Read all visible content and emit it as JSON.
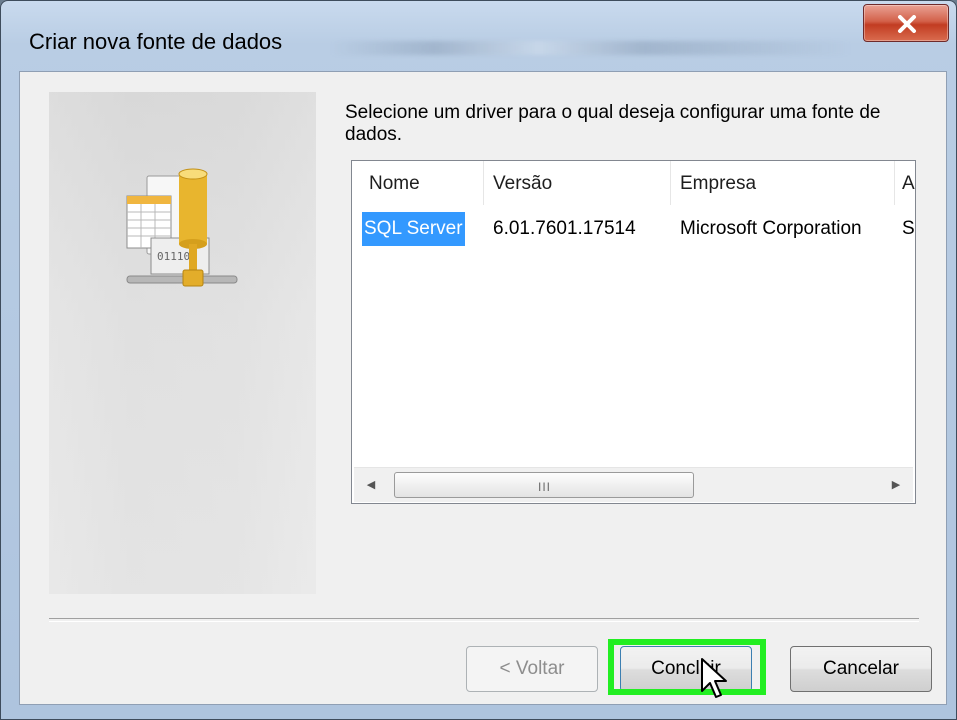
{
  "window": {
    "title": "Criar nova fonte de dados",
    "close_icon": "close-icon"
  },
  "side_panel": {
    "icon": "data-source-driver-icon"
  },
  "instruction": "Selecione um driver para o qual deseja configurar uma fonte de dados.",
  "driver_list": {
    "columns": [
      "Nome",
      "Versão",
      "Empresa",
      "A"
    ],
    "rows": [
      {
        "name": "SQL Server",
        "version": "6.01.7601.17514",
        "company": "Microsoft Corporation",
        "extra": "S",
        "selected": true
      }
    ],
    "scrollbar": {
      "left_icon": "scroll-left-icon",
      "right_icon": "scroll-right-icon",
      "grip": "III"
    }
  },
  "buttons": {
    "back_label": "< Voltar",
    "finish_label": "Concluir",
    "cancel_label": "Cancelar"
  },
  "colors": {
    "selection": "#3399ff",
    "highlight_box": "#22ee22",
    "close_button": "#c94b2f"
  }
}
